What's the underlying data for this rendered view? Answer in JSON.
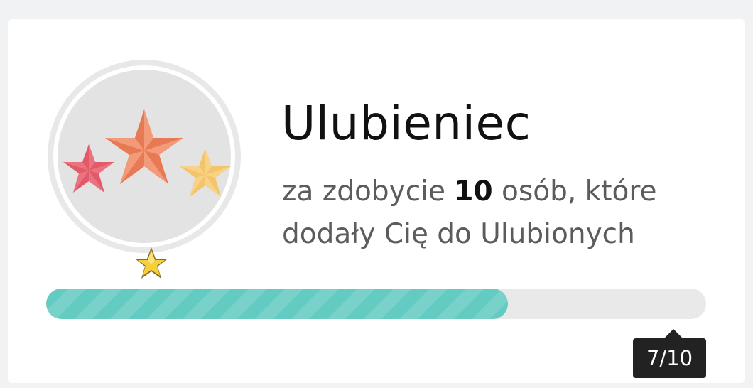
{
  "achievement": {
    "title": "Ulubieniec",
    "desc_prefix": "za zdobycie ",
    "desc_count": "10",
    "desc_suffix": " osób, które dodały Cię do Ulubionych",
    "badge_icon": "three-stars-badge-icon",
    "level_icon": "gold-star-level-icon"
  },
  "progress": {
    "current": 7,
    "total": 10,
    "fraction": 0.7,
    "label": "7/10"
  },
  "colors": {
    "progress_fill": "#63cbc1",
    "star_red": "#e25a68",
    "star_orange": "#ef8660",
    "star_yellow": "#f3c46a",
    "badge_bg": "#e3e3e3",
    "tooltip_bg": "#222222"
  }
}
